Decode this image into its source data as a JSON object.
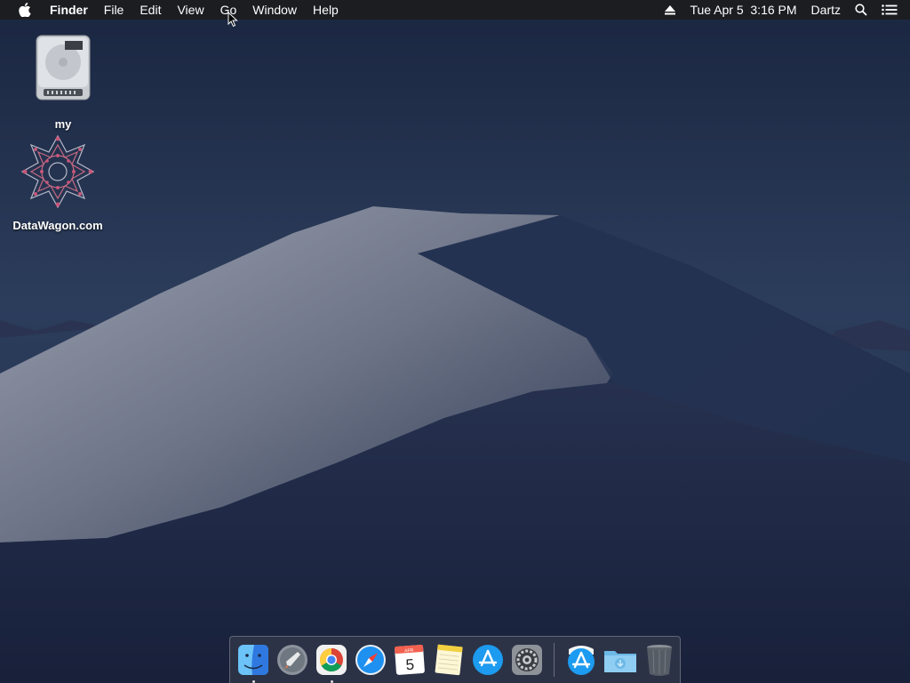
{
  "menubar": {
    "app_name": "Finder",
    "menus": [
      "File",
      "Edit",
      "View",
      "Go",
      "Window",
      "Help"
    ],
    "datetime": "Tue Apr 5  3:16 PM",
    "user": "Dartz",
    "icons": [
      "apple-icon",
      "eject-icon",
      "spotlight-icon",
      "notification-center-icon"
    ]
  },
  "desktop": {
    "icons": [
      {
        "label": "my",
        "icon": "hard-drive-icon"
      },
      {
        "label": "DataWagon.com",
        "icon": "datawagon-logo-icon"
      }
    ]
  },
  "dock": {
    "apps": [
      {
        "name": "Finder",
        "icon": "finder-icon",
        "running": true
      },
      {
        "name": "Launchpad",
        "icon": "launchpad-icon",
        "running": false
      },
      {
        "name": "Google Chrome",
        "icon": "chrome-icon",
        "running": true
      },
      {
        "name": "Safari",
        "icon": "safari-icon",
        "running": false
      },
      {
        "name": "Calendar",
        "icon": "calendar-icon",
        "running": false,
        "day": "5",
        "month": "APR"
      },
      {
        "name": "Notes",
        "icon": "notes-icon",
        "running": false
      },
      {
        "name": "App Store",
        "icon": "app-store-icon",
        "running": false
      },
      {
        "name": "System Preferences",
        "icon": "system-preferences-icon",
        "running": false
      }
    ],
    "stacks": [
      {
        "name": "Applications",
        "icon": "app-store-stack-icon"
      },
      {
        "name": "Downloads",
        "icon": "downloads-folder-icon"
      },
      {
        "name": "Trash",
        "icon": "trash-icon"
      }
    ]
  },
  "colors": {
    "menubar_bg": "#1c1c1e",
    "sky": "#1e2b46",
    "dune_light": "#8d93a3"
  }
}
